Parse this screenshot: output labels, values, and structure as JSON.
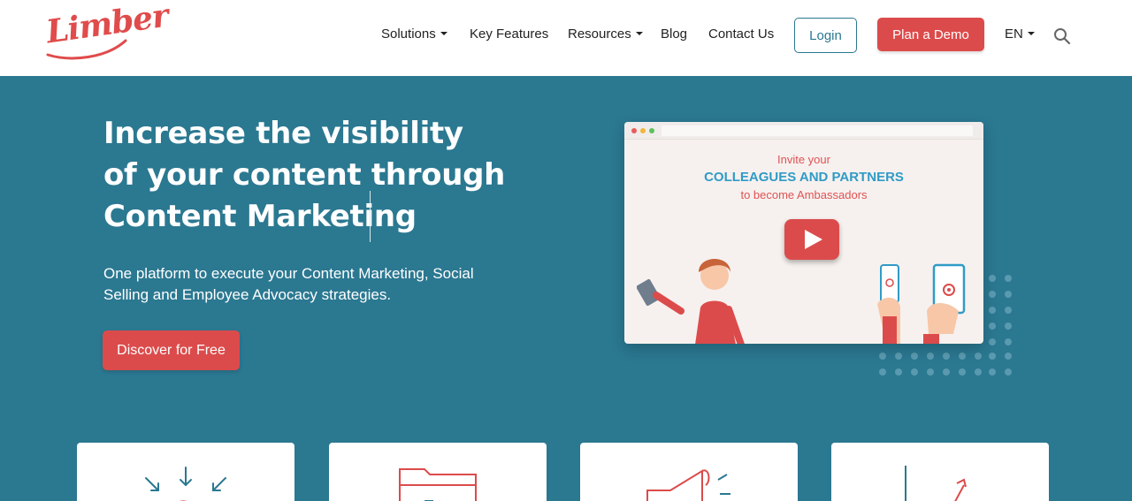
{
  "header": {
    "logo_text": "Limber",
    "nav": [
      {
        "label": "Solutions",
        "has_dropdown": true
      },
      {
        "label": "Key Features",
        "has_dropdown": false
      },
      {
        "label": "Resources",
        "has_dropdown": true
      },
      {
        "label": "Blog",
        "has_dropdown": false
      },
      {
        "label": "Contact Us",
        "has_dropdown": false
      }
    ],
    "login_label": "Login",
    "demo_label": "Plan a Demo",
    "language": "EN"
  },
  "hero": {
    "title_lines": [
      "Increase the visibility",
      "of your content through",
      "Content Marketing"
    ],
    "subtitle": "One platform to execute your Content Marketing, Social Selling and Employee Advocacy strategies.",
    "cta_label": "Discover for Free"
  },
  "video": {
    "line1": "Invite your",
    "line2": "COLLEAGUES AND PARTNERS",
    "line3": "to become Ambassadors"
  },
  "colors": {
    "brand_red": "#dc4b4b",
    "brand_teal": "#2b7891",
    "video_highlight": "#2f9bc6"
  },
  "cards": [
    {
      "icon": "download-cloud-icon"
    },
    {
      "icon": "calendar-icon"
    },
    {
      "icon": "megaphone-icon"
    },
    {
      "icon": "growth-chart-icon"
    }
  ]
}
